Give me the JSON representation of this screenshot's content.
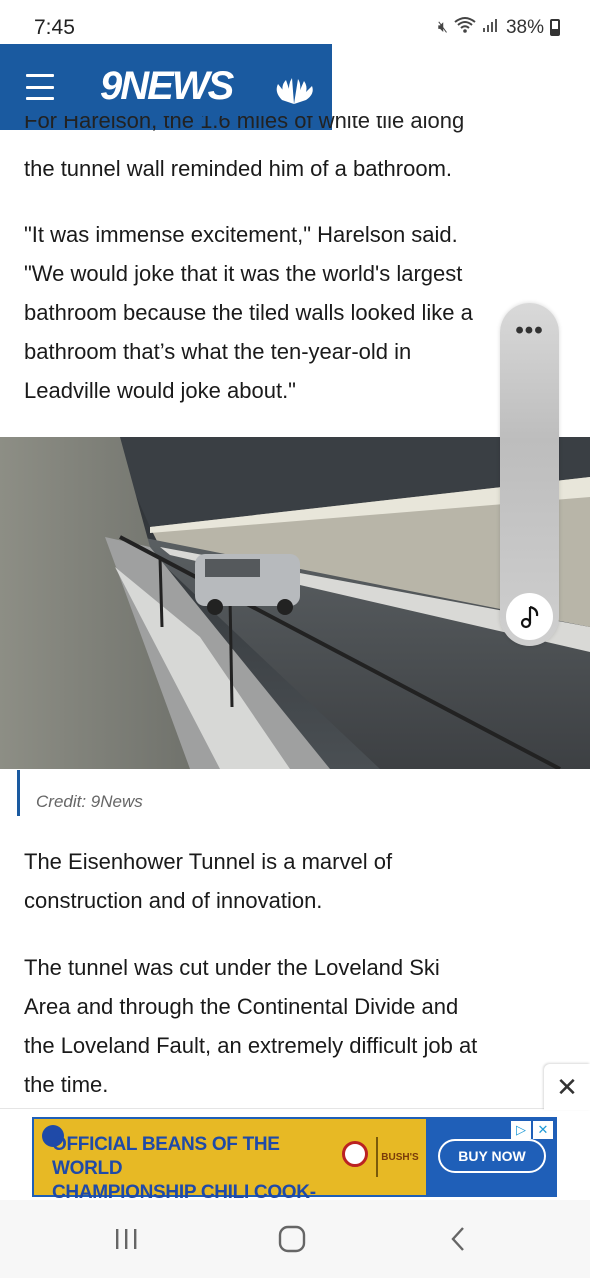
{
  "status_bar": {
    "time": "7:45",
    "battery": "38%"
  },
  "header": {
    "logo": "9NEWS"
  },
  "article": {
    "cutline": "For Harelson, the 1.6 miles of white tile along",
    "paragraphs": [
      "the tunnel wall reminded him of a bathroom.",
      "\"It was immense excitement,\" Harelson said.\n\"We would joke that it was the world's largest\nbathroom because the tiled walls looked like a\nbathroom that’s what the ten-year-old in\nLeadville would joke about.\"",
      "The Eisenhower Tunnel is a marvel of\nconstruction and of innovation.",
      "The tunnel was cut under the Loveland Ski\nArea and through the Continental Divide and\nthe Loveland Fault, an extremely difficult job at\nthe time."
    ],
    "photo_credit": "Credit: 9News"
  },
  "side_widget": {
    "menu_glyph": "•••",
    "music_icon": "music-note-icon"
  },
  "ad": {
    "line1": "OFFICIAL BEANS OF THE WORLD",
    "line2": "CHAMPIONSHIP CHILI COOK-OFFS®",
    "brand": "BUSH'S",
    "cta": "BUY NOW",
    "close_glyph": "✕"
  },
  "nav": {
    "recents_icon": "recents-icon",
    "home_icon": "home-icon",
    "back_icon": "back-icon"
  },
  "colors": {
    "brand_blue": "#1a5aa0",
    "ad_yellow": "#e7b925",
    "ad_blue": "#1f5fb8"
  }
}
